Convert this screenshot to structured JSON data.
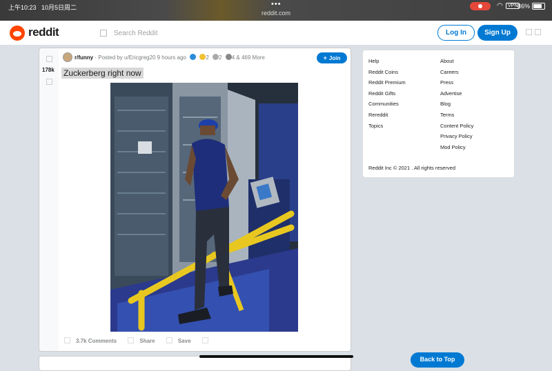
{
  "status_bar": {
    "time": "上午10:23",
    "date": "10月5日周二",
    "url": "reddit.com",
    "dots": "•••",
    "battery": "86%"
  },
  "header": {
    "logo_text": "reddit",
    "search_placeholder": "Search Reddit",
    "login_label": "Log In",
    "signup_label": "Sign Up"
  },
  "post": {
    "score": "178k",
    "subreddit": "r/funny",
    "posted_by": "· Posted by u/Ericgreg20 9 hours ago",
    "award_counts": [
      "2",
      "2",
      "4"
    ],
    "more_awards": "& 469 More",
    "join_label": "Join",
    "title": "Zuckerberg right now",
    "comments_label": "3.7k Comments",
    "share_label": "Share",
    "save_label": "Save"
  },
  "sidebar": {
    "col1": [
      "Help",
      "Reddit Coins",
      "Reddit Premium",
      "Reddit Gifts",
      "Communities",
      "Rereddit",
      "Topics"
    ],
    "col2": [
      "About",
      "Careers",
      "Press",
      "Advertise",
      "Blog",
      "Terms",
      "Content Policy",
      "Privacy Policy",
      "Mod Policy"
    ],
    "copyright": "Reddit Inc © 2021 . All rights reserved"
  },
  "back_to_top_label": "Back to Top",
  "colors": {
    "accent": "#0079d3",
    "brand": "#ff4500",
    "background": "#dae0e6"
  }
}
